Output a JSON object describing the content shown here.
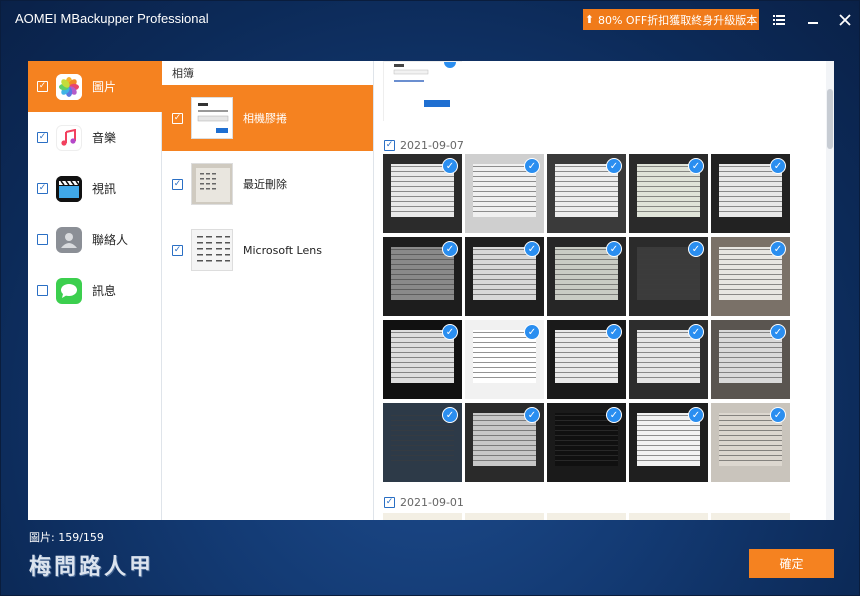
{
  "app": {
    "title": "AOMEI MBackupper Professional",
    "promo_label": "80% OFF折扣獲取終身升級版本"
  },
  "categories": [
    {
      "label": "圖片",
      "checked": true,
      "active": true,
      "icon": "photos-icon"
    },
    {
      "label": "音樂",
      "checked": true,
      "active": false,
      "icon": "music-icon"
    },
    {
      "label": "視訊",
      "checked": true,
      "active": false,
      "icon": "video-icon"
    },
    {
      "label": "聯絡人",
      "checked": false,
      "active": false,
      "icon": "contacts-icon"
    },
    {
      "label": "訊息",
      "checked": false,
      "active": false,
      "icon": "messages-icon"
    }
  ],
  "albums": {
    "header": "相簿",
    "items": [
      {
        "label": "相機膠捲",
        "checked": true,
        "active": true
      },
      {
        "label": "最近刪除",
        "checked": true,
        "active": false
      },
      {
        "label": "Microsoft Lens",
        "checked": true,
        "active": false
      }
    ]
  },
  "photos": {
    "groups": [
      {
        "date": "2021-09-07",
        "checked": true,
        "count": 20
      },
      {
        "date": "2021-09-01",
        "checked": true,
        "count": 5
      }
    ]
  },
  "status": {
    "selected_text": "圖片: 159/159"
  },
  "watermark": "梅問路人甲",
  "footer": {
    "ok_label": "確定"
  },
  "colors": {
    "accent": "#f58220",
    "check_blue": "#2a8ef0"
  }
}
